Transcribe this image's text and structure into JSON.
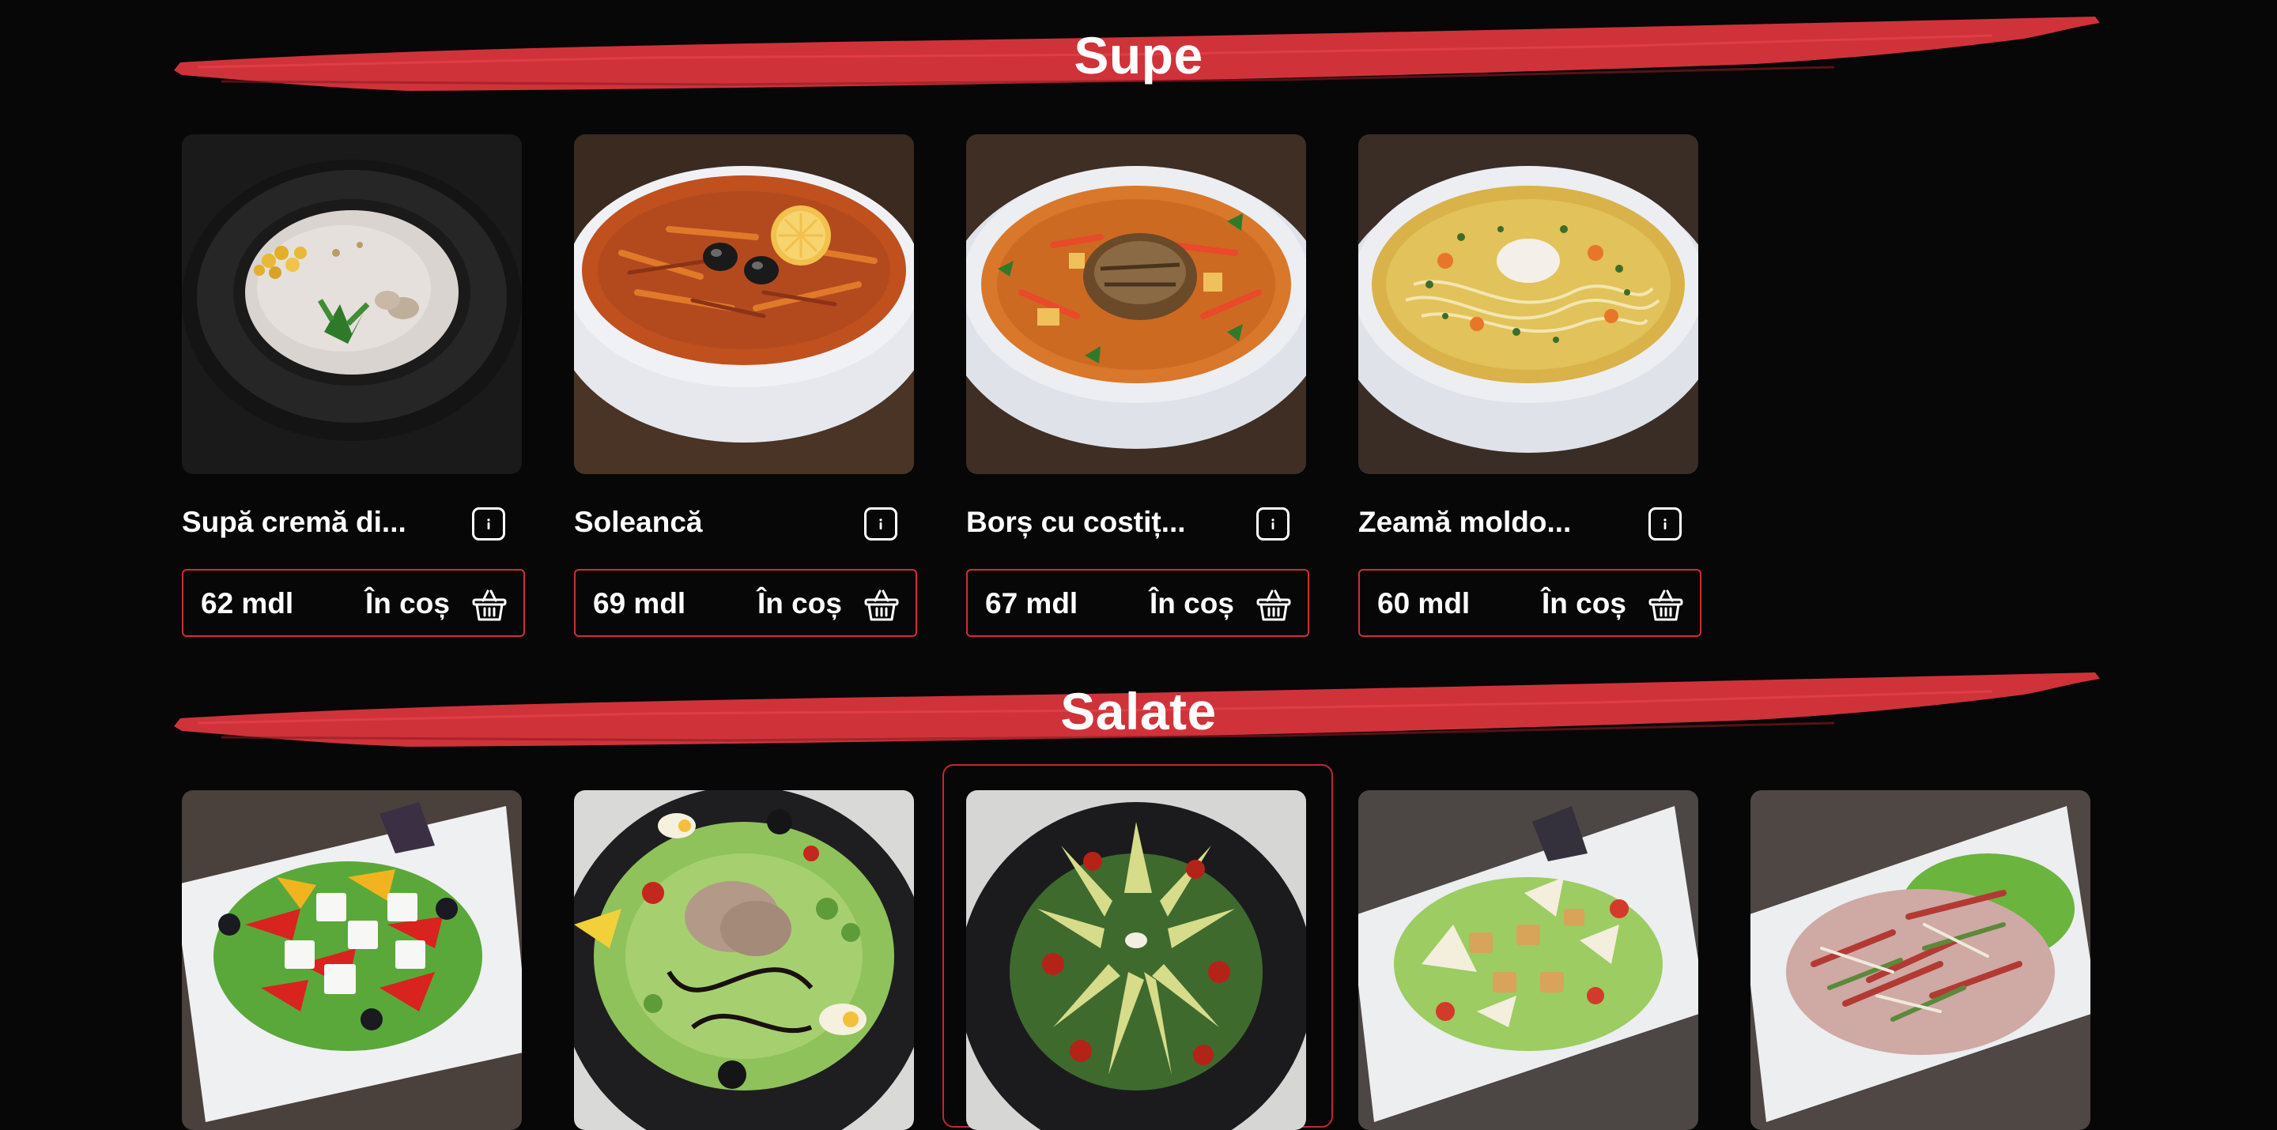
{
  "sections": [
    {
      "title": "Supe",
      "items": [
        {
          "name": "Supă cremă di...",
          "price": "62 mdl",
          "cart_label": "În coș",
          "image": "cream-soup-photo"
        },
        {
          "name": "Soleancă",
          "price": "69 mdl",
          "cart_label": "În coș",
          "image": "solyanka-photo"
        },
        {
          "name": "Borș cu costiț...",
          "price": "67 mdl",
          "cart_label": "În coș",
          "image": "borsch-photo"
        },
        {
          "name": "Zeamă moldo...",
          "price": "60 mdl",
          "cart_label": "În coș",
          "image": "zeama-photo"
        }
      ]
    },
    {
      "title": "Salate",
      "items": [
        {
          "image": "greek-salad-photo"
        },
        {
          "image": "tuna-salad-photo"
        },
        {
          "image": "avocado-salad-photo"
        },
        {
          "image": "caesar-salad-photo"
        },
        {
          "image": "meat-salad-photo"
        }
      ]
    }
  ],
  "icons": {
    "info": "info-icon",
    "cart": "basket-icon"
  },
  "colors": {
    "accent": "#d12d36",
    "background": "#070707",
    "text": "#ffffff"
  }
}
